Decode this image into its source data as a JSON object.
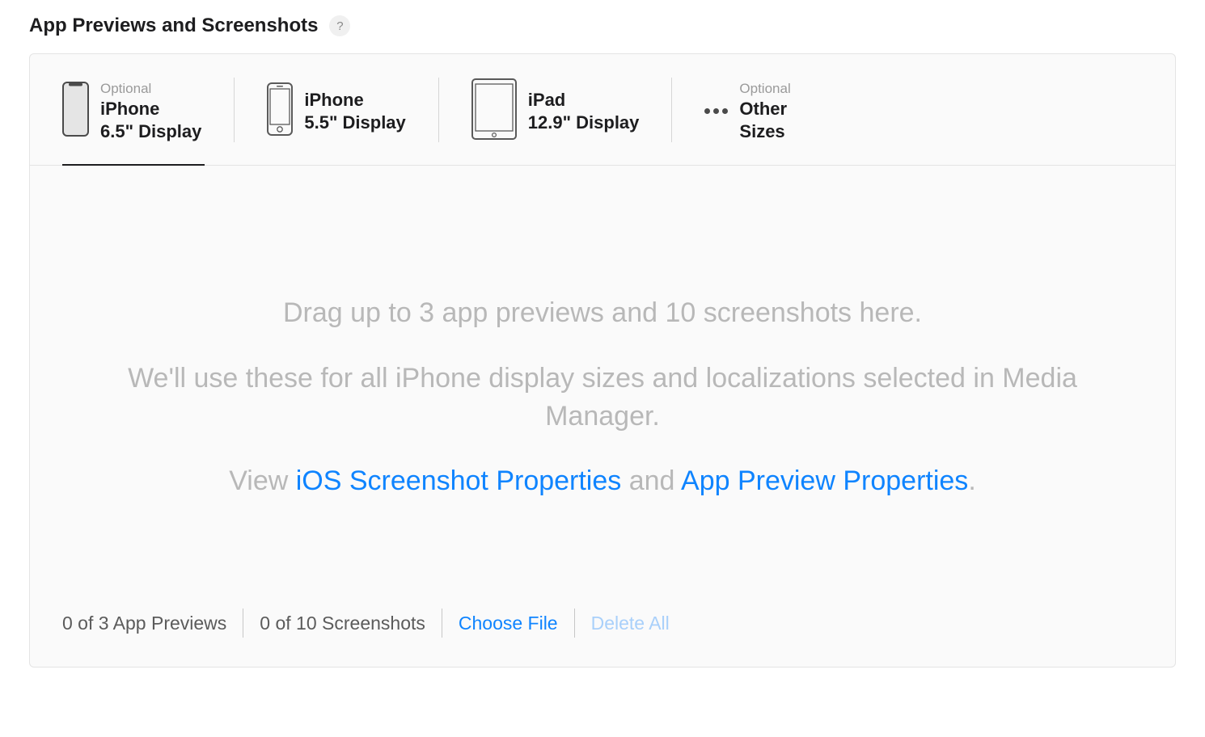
{
  "section": {
    "title": "App Previews and Screenshots"
  },
  "tabs": [
    {
      "optional": "Optional",
      "line1": "iPhone",
      "line2": "6.5\" Display",
      "active": true
    },
    {
      "optional": "",
      "line1": "iPhone",
      "line2": "5.5\" Display",
      "active": false
    },
    {
      "optional": "",
      "line1": "iPad",
      "line2": "12.9\" Display",
      "active": false
    },
    {
      "optional": "Optional",
      "line1": "Other",
      "line2": "Sizes",
      "active": false
    }
  ],
  "dropzone": {
    "line1": "Drag up to 3 app previews and 10 screenshots here.",
    "line2": "We'll use these for all iPhone display sizes and localizations selected in Media Manager.",
    "view_prefix": "View ",
    "link1": "iOS Screenshot Properties",
    "and": " and ",
    "link2": "App Preview Properties",
    "period": "."
  },
  "footer": {
    "app_previews_count": "0 of 3 App Previews",
    "screenshots_count": "0 of 10 Screenshots",
    "choose_file": "Choose File",
    "delete_all": "Delete All"
  }
}
